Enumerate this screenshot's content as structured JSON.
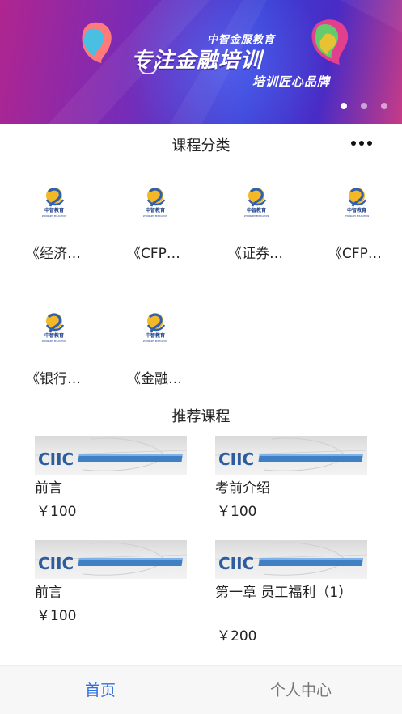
{
  "banner": {
    "small_text": "中智金服教育",
    "big_text": "专注金融培训",
    "tagline": "培训匠心品牌",
    "carousel_total": 3,
    "carousel_active": 1
  },
  "categories_section": {
    "title": "课程分类",
    "more_icon": "more-horizontal-icon",
    "logo_text": "中智教育",
    "logo_subtext": "ZHONGZHI EDUCATION",
    "items": [
      {
        "label": "《经济…"
      },
      {
        "label": "《CFP…"
      },
      {
        "label": "《证券…"
      },
      {
        "label": "《CFP…"
      },
      {
        "label": "《银行…"
      },
      {
        "label": "《金融…"
      }
    ]
  },
  "recommended_section": {
    "title": "推荐课程",
    "thumb_brand": "CIIC",
    "courses": [
      {
        "title": "前言",
        "price": "￥100"
      },
      {
        "title": "考前介绍",
        "price": "￥100"
      },
      {
        "title": "前言",
        "price": "￥100"
      },
      {
        "title": "第一章 员工福利（1）",
        "price": "￥200"
      }
    ]
  },
  "tabbar": {
    "tabs": [
      {
        "label": "首页",
        "active": true
      },
      {
        "label": "个人中心",
        "active": false
      }
    ],
    "active_color": "#2f6fe0",
    "inactive_color": "#777777"
  }
}
